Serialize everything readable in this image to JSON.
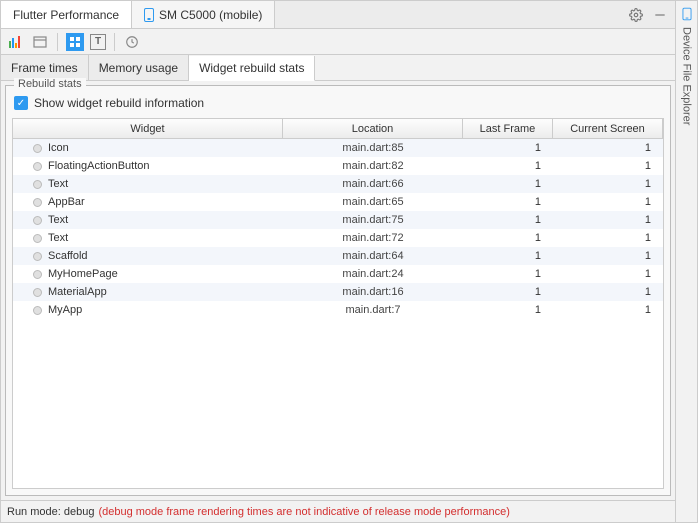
{
  "topTabs": {
    "flutter": "Flutter Performance",
    "device": "SM C5000 (mobile)"
  },
  "subTabs": {
    "frameTimes": "Frame times",
    "memory": "Memory usage",
    "rebuild": "Widget rebuild stats"
  },
  "fieldset": {
    "legend": "Rebuild stats",
    "checkboxLabel": "Show widget rebuild information"
  },
  "tableHeaders": {
    "widget": "Widget",
    "location": "Location",
    "lastFrame": "Last Frame",
    "currentScreen": "Current Screen"
  },
  "rows": [
    {
      "widget": "Icon",
      "location": "main.dart:85",
      "lastFrame": "1",
      "currentScreen": "1"
    },
    {
      "widget": "FloatingActionButton",
      "location": "main.dart:82",
      "lastFrame": "1",
      "currentScreen": "1"
    },
    {
      "widget": "Text",
      "location": "main.dart:66",
      "lastFrame": "1",
      "currentScreen": "1"
    },
    {
      "widget": "AppBar",
      "location": "main.dart:65",
      "lastFrame": "1",
      "currentScreen": "1"
    },
    {
      "widget": "Text",
      "location": "main.dart:75",
      "lastFrame": "1",
      "currentScreen": "1"
    },
    {
      "widget": "Text",
      "location": "main.dart:72",
      "lastFrame": "1",
      "currentScreen": "1"
    },
    {
      "widget": "Scaffold",
      "location": "main.dart:64",
      "lastFrame": "1",
      "currentScreen": "1"
    },
    {
      "widget": "MyHomePage",
      "location": "main.dart:24",
      "lastFrame": "1",
      "currentScreen": "1"
    },
    {
      "widget": "MaterialApp",
      "location": "main.dart:16",
      "lastFrame": "1",
      "currentScreen": "1"
    },
    {
      "widget": "MyApp",
      "location": "main.dart:7",
      "lastFrame": "1",
      "currentScreen": "1"
    }
  ],
  "footer": {
    "label": "Run mode: debug",
    "note": "(debug mode frame rendering times are not indicative of release mode performance)"
  },
  "sidePanel": {
    "label": "Device File Explorer"
  }
}
